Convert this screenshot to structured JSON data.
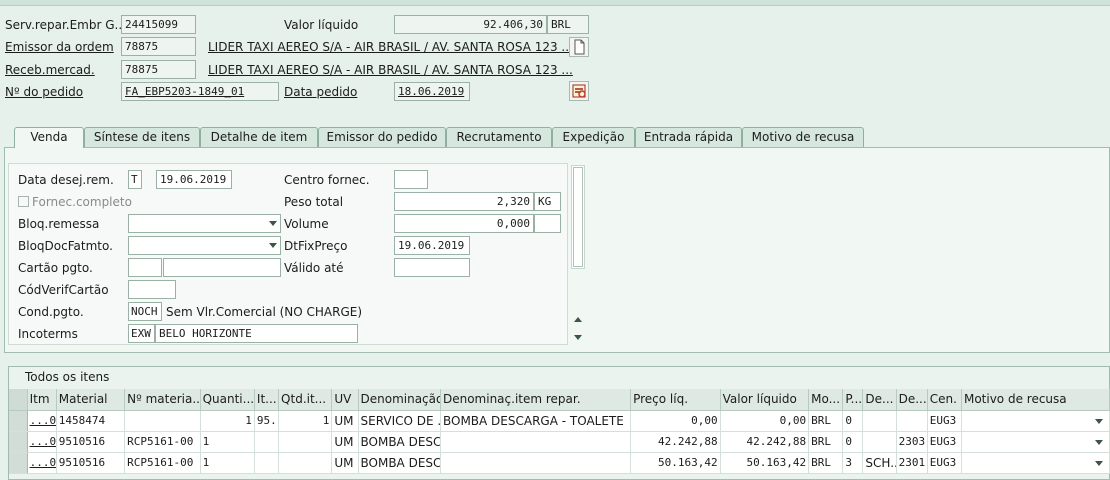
{
  "header": {
    "serv_label": "Serv.repar.Embr G...",
    "serv_value": "24415099",
    "valor_label": "Valor líquido",
    "valor_value": "92.406,30",
    "valor_currency": "BRL",
    "emissor_label": "Emissor da ordem",
    "emissor_value": "78875",
    "emissor_name": "LIDER TAXI AEREO S/A - AIR BRASIL / AV. SANTA ROSA 123 ...",
    "receb_label": "Receb.mercad.",
    "receb_value": "78875",
    "receb_name": "LIDER TAXI AEREO S/A - AIR BRASIL / AV. SANTA ROSA 123 ...",
    "pedido_label": "Nº do pedido",
    "pedido_value": "FA_EBP5203-1849_01",
    "data_pedido_label": "Data pedido",
    "data_pedido_value": "18.06.2019"
  },
  "tabs": [
    {
      "label": "Venda"
    },
    {
      "label": "Síntese de itens"
    },
    {
      "label": "Detalhe de item"
    },
    {
      "label": "Emissor do pedido"
    },
    {
      "label": "Recrutamento"
    },
    {
      "label": "Expedição"
    },
    {
      "label": "Entrada rápida"
    },
    {
      "label": "Motivo de recusa"
    }
  ],
  "venda": {
    "data_desej_label": "Data desej.rem.",
    "data_desej_type": "T",
    "data_desej_value": "19.06.2019",
    "centro_label": "Centro fornec.",
    "centro_value": "",
    "fornec_completo_label": "Fornec.completo",
    "peso_label": "Peso total",
    "peso_value": "2,320",
    "peso_unit": "KG",
    "bloq_remessa_label": "Bloq.remessa",
    "bloq_remessa_value": "",
    "volume_label": "Volume",
    "volume_value": "0,000",
    "volume_unit": "",
    "bloq_fat_label": "BloqDocFatmto.",
    "bloq_fat_value": "",
    "dtfix_label": "DtFixPreço",
    "dtfix_value": "19.06.2019",
    "cartao_label": "Cartão pgto.",
    "valido_label": "Válido até",
    "codverif_label": "CódVerifCartão",
    "cond_label": "Cond.pgto.",
    "cond_value": "NOCH",
    "cond_text": "Sem Vlr.Comercial (NO CHARGE)",
    "incoterms_label": "Incoterms",
    "incoterms_value": "EXW",
    "incoterms_text": "BELO HORIZONTE"
  },
  "items": {
    "section_title": "Todos os itens",
    "columns": [
      "Itm",
      "Material",
      "Nº materia...",
      "Quanti...",
      "It...",
      "Qtd.it...",
      "UV",
      "Denominação",
      "Denominaç.item repar.",
      "Preço líq.",
      "Valor líquido",
      "Mo...",
      "P...",
      "De...",
      "De...",
      "Cen.",
      "Motivo de recusa"
    ],
    "rows": [
      [
        "...00",
        "1458474",
        "",
        "1",
        "95...",
        "1",
        "UM",
        "SERVICO DE ...",
        "BOMBA DESCARGA - TOALETE",
        "0,00",
        "0,00",
        "BRL",
        "0",
        "",
        "",
        "EUG3",
        ""
      ],
      [
        "...00",
        "9510516",
        "RCP5161-00",
        "1",
        "",
        "",
        "UM",
        "BOMBA DESC...",
        "",
        "42.242,88",
        "42.242,88",
        "BRL",
        "0",
        "",
        "2303",
        "EUG3",
        ""
      ],
      [
        "...00",
        "9510516",
        "RCP5161-00",
        "1",
        "",
        "",
        "UM",
        "BOMBA DESC...",
        "",
        "50.163,42",
        "50.163,42",
        "BRL",
        "3",
        "SCH...",
        "2301",
        "EUG3",
        ""
      ]
    ]
  }
}
